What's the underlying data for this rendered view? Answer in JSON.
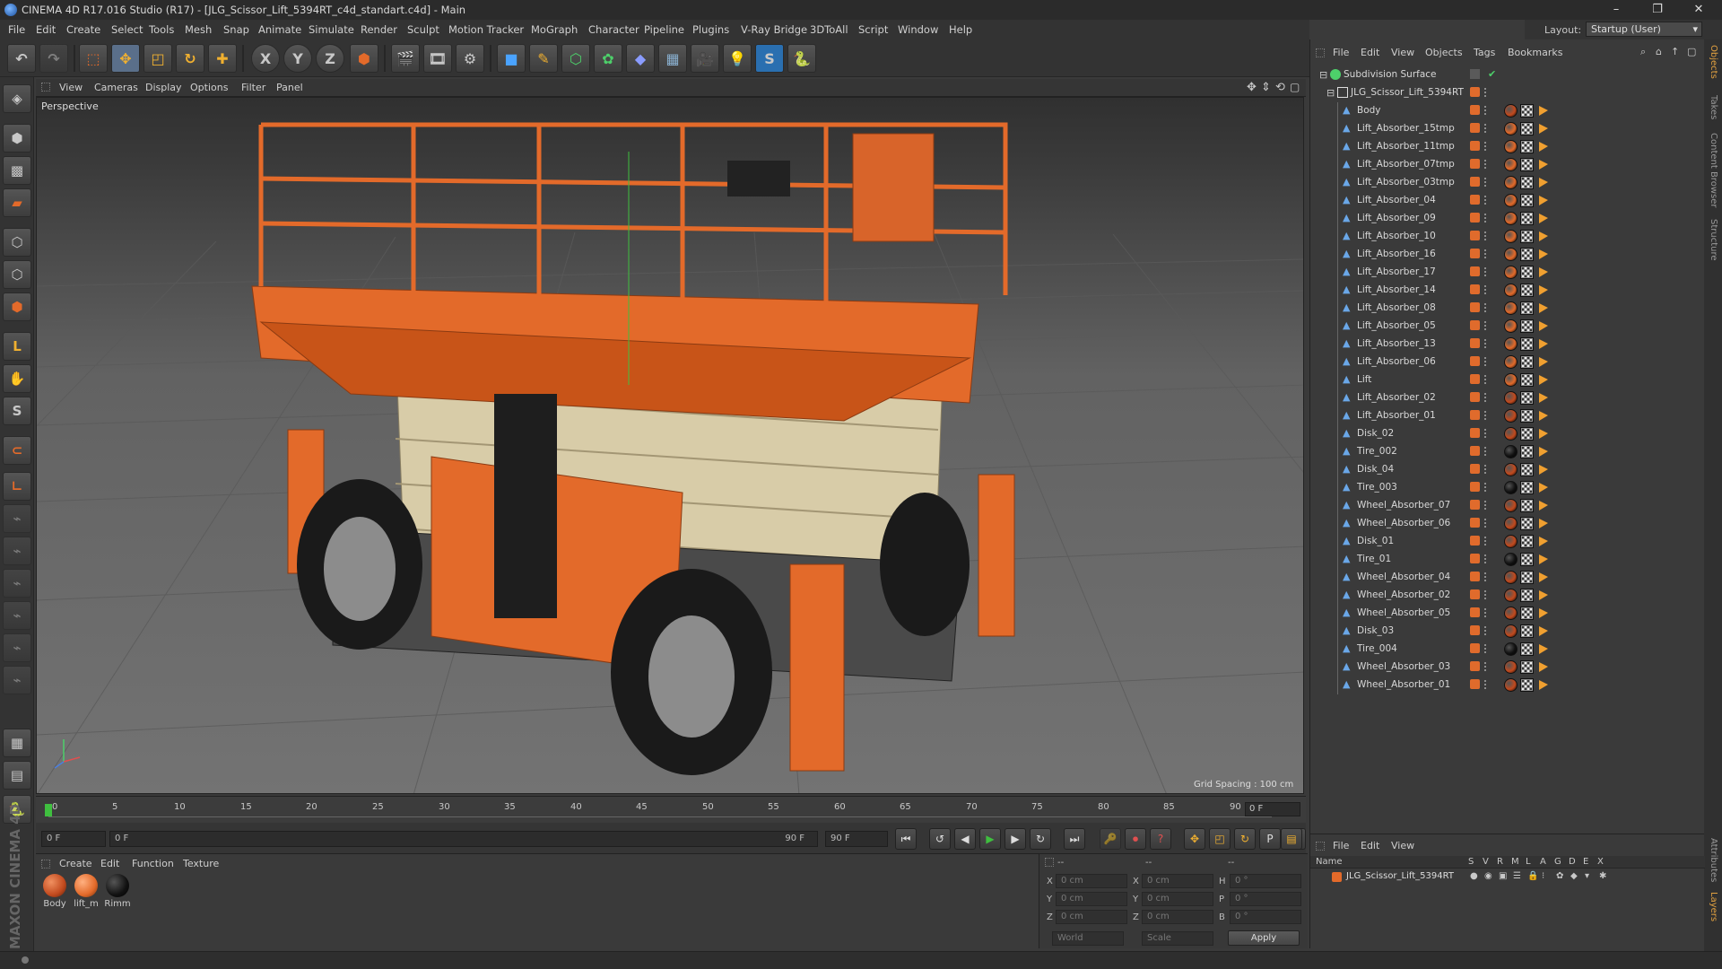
{
  "app": {
    "window_title": "CINEMA 4D R17.016 Studio (R17) - [JLG_Scissor_Lift_5394RT_c4d_standart.c4d] - Main",
    "minimize": "–",
    "maximize": "❐",
    "close": "✕"
  },
  "menu": [
    "File",
    "Edit",
    "Create",
    "Select",
    "Tools",
    "Mesh",
    "Snap",
    "Animate",
    "Simulate",
    "Render",
    "Sculpt",
    "Motion Tracker",
    "MoGraph",
    "Character",
    "Pipeline",
    "Plugins",
    "V-Ray Bridge",
    "3DToAll",
    "Script",
    "Window",
    "Help"
  ],
  "layout": {
    "label": "Layout:",
    "value": "Startup (User)"
  },
  "toolbar": {
    "axis_x": "X",
    "axis_y": "Y",
    "axis_z": "Z"
  },
  "viewport": {
    "menu": [
      "View",
      "Cameras",
      "Display",
      "Options",
      "Filter",
      "Panel"
    ],
    "label": "Perspective",
    "grid_spacing": "Grid Spacing : 100 cm"
  },
  "timeline": {
    "ticks": [
      "0",
      "5",
      "10",
      "15",
      "20",
      "25",
      "30",
      "35",
      "40",
      "45",
      "50",
      "55",
      "60",
      "65",
      "70",
      "75",
      "80",
      "85",
      "90"
    ],
    "current_frame": "0 F",
    "start_field": "0 F",
    "range_start": "0 F",
    "range_end": "90 F",
    "end_field": "90 F"
  },
  "materials": {
    "menu": [
      "Create",
      "Edit",
      "Function",
      "Texture"
    ],
    "items": [
      {
        "name": "Body",
        "color": "#c24a1e"
      },
      {
        "name": "lift_m",
        "color": "#e36a2a"
      },
      {
        "name": "Rimm",
        "color": "#111111"
      }
    ]
  },
  "coords": {
    "header1": "--",
    "header2": "--",
    "header3": "--",
    "rows": [
      {
        "a": "X",
        "av": "0 cm",
        "b": "X",
        "bv": "0 cm",
        "c": "H",
        "cv": "0 °"
      },
      {
        "a": "Y",
        "av": "0 cm",
        "b": "Y",
        "bv": "0 cm",
        "c": "P",
        "cv": "0 °"
      },
      {
        "a": "Z",
        "av": "0 cm",
        "b": "Z",
        "bv": "0 cm",
        "c": "B",
        "cv": "0 °"
      }
    ],
    "mode1": "World",
    "mode2": "Scale",
    "apply": "Apply"
  },
  "objects": {
    "menu": [
      "File",
      "Edit",
      "View",
      "Objects",
      "Tags",
      "Bookmarks"
    ],
    "root": "Subdivision Surface",
    "group": "JLG_Scissor_Lift_5394RT",
    "children": [
      {
        "name": "Body",
        "tag": "#c24a1e"
      },
      {
        "name": "Lift_Absorber_15tmp",
        "tag": "#e36a2a"
      },
      {
        "name": "Lift_Absorber_11tmp",
        "tag": "#e36a2a"
      },
      {
        "name": "Lift_Absorber_07tmp",
        "tag": "#e36a2a"
      },
      {
        "name": "Lift_Absorber_03tmp",
        "tag": "#e36a2a"
      },
      {
        "name": "Lift_Absorber_04",
        "tag": "#e36a2a"
      },
      {
        "name": "Lift_Absorber_09",
        "tag": "#e36a2a"
      },
      {
        "name": "Lift_Absorber_10",
        "tag": "#e36a2a"
      },
      {
        "name": "Lift_Absorber_16",
        "tag": "#e36a2a"
      },
      {
        "name": "Lift_Absorber_17",
        "tag": "#e36a2a"
      },
      {
        "name": "Lift_Absorber_14",
        "tag": "#e36a2a"
      },
      {
        "name": "Lift_Absorber_08",
        "tag": "#e36a2a"
      },
      {
        "name": "Lift_Absorber_05",
        "tag": "#e36a2a"
      },
      {
        "name": "Lift_Absorber_13",
        "tag": "#e36a2a"
      },
      {
        "name": "Lift_Absorber_06",
        "tag": "#e36a2a"
      },
      {
        "name": "Lift",
        "tag": "#e36a2a"
      },
      {
        "name": "Lift_Absorber_02",
        "tag": "#c24a1e"
      },
      {
        "name": "Lift_Absorber_01",
        "tag": "#c24a1e"
      },
      {
        "name": "Disk_02",
        "tag": "#c24a1e"
      },
      {
        "name": "Tire_002",
        "tag": "#111111"
      },
      {
        "name": "Disk_04",
        "tag": "#c24a1e"
      },
      {
        "name": "Tire_003",
        "tag": "#111111"
      },
      {
        "name": "Wheel_Absorber_07",
        "tag": "#c24a1e"
      },
      {
        "name": "Wheel_Absorber_06",
        "tag": "#c24a1e"
      },
      {
        "name": "Disk_01",
        "tag": "#c24a1e"
      },
      {
        "name": "Tire_01",
        "tag": "#111111"
      },
      {
        "name": "Wheel_Absorber_04",
        "tag": "#c24a1e"
      },
      {
        "name": "Wheel_Absorber_02",
        "tag": "#c24a1e"
      },
      {
        "name": "Wheel_Absorber_05",
        "tag": "#c24a1e"
      },
      {
        "name": "Disk_03",
        "tag": "#c24a1e"
      },
      {
        "name": "Tire_004",
        "tag": "#111111"
      },
      {
        "name": "Wheel_Absorber_03",
        "tag": "#c24a1e"
      },
      {
        "name": "Wheel_Absorber_01",
        "tag": "#c24a1e"
      }
    ]
  },
  "side_tabs": [
    "Objects",
    "Takes",
    "Content Browser",
    "Structure"
  ],
  "side_tabs_bottom": [
    "Attributes",
    "Layers"
  ],
  "layers": {
    "menu": [
      "File",
      "Edit",
      "View"
    ],
    "col_name": "Name",
    "cols": [
      "S",
      "V",
      "R",
      "M",
      "L",
      "A",
      "G",
      "D",
      "E",
      "X"
    ],
    "row": "JLG_Scissor_Lift_5394RT"
  },
  "brand": "MAXON CINEMA 4D",
  "colors": {
    "orange": "#e36a2a",
    "accent_blue": "#3a8fe0",
    "bg": "#3a3a3a"
  }
}
